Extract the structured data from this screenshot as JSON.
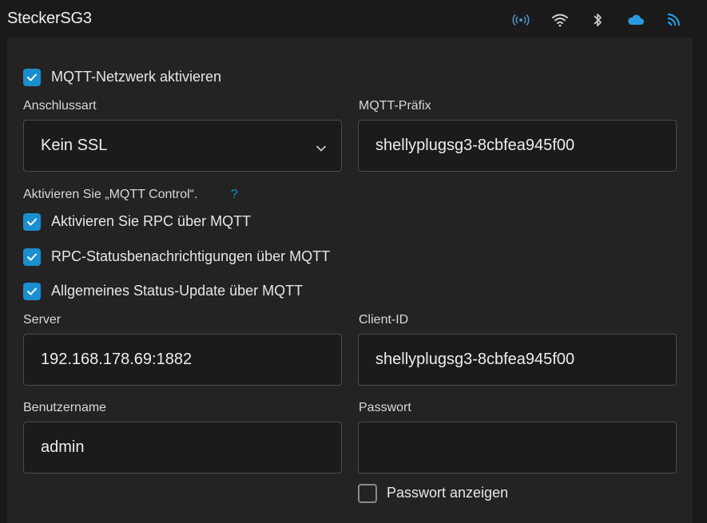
{
  "header": {
    "title": "SteckerSG3",
    "icons": [
      {
        "name": "ap-signal-icon",
        "color": "#4a90c2"
      },
      {
        "name": "wifi-icon",
        "color": "#d0d0d0"
      },
      {
        "name": "bluetooth-icon",
        "color": "#c8c8c8"
      },
      {
        "name": "cloud-icon",
        "color": "#2a9ae0"
      },
      {
        "name": "mqtt-feed-icon",
        "color": "#2a9ae0"
      }
    ]
  },
  "mqtt": {
    "enable_label": "MQTT-Netzwerk aktivieren",
    "enable_checked": true,
    "connection_type_label": "Anschlussart",
    "connection_type_value": "Kein SSL",
    "prefix_label": "MQTT-Präfix",
    "prefix_value": "shellyplugsg3-8cbfea945f00",
    "control_heading": "Aktivieren Sie „MQTT Control“.",
    "control_help": "?",
    "rpc_label": "Aktivieren Sie RPC über MQTT",
    "rpc_checked": true,
    "rpc_status_label": "RPC-Statusbenachrichtigungen über MQTT",
    "rpc_status_checked": true,
    "general_status_label": "Allgemeines Status-Update über MQTT",
    "general_status_checked": true,
    "server_label": "Server",
    "server_value": "192.168.178.69:1882",
    "client_id_label": "Client-ID",
    "client_id_value": "shellyplugsg3-8cbfea945f00",
    "username_label": "Benutzername",
    "username_value": "admin",
    "password_label": "Passwort",
    "password_value": "",
    "show_password_label": "Passwort anzeigen",
    "show_password_checked": false
  },
  "colors": {
    "accent": "#1a8fcf",
    "background": "#1a1a1a",
    "panel": "#232323"
  }
}
